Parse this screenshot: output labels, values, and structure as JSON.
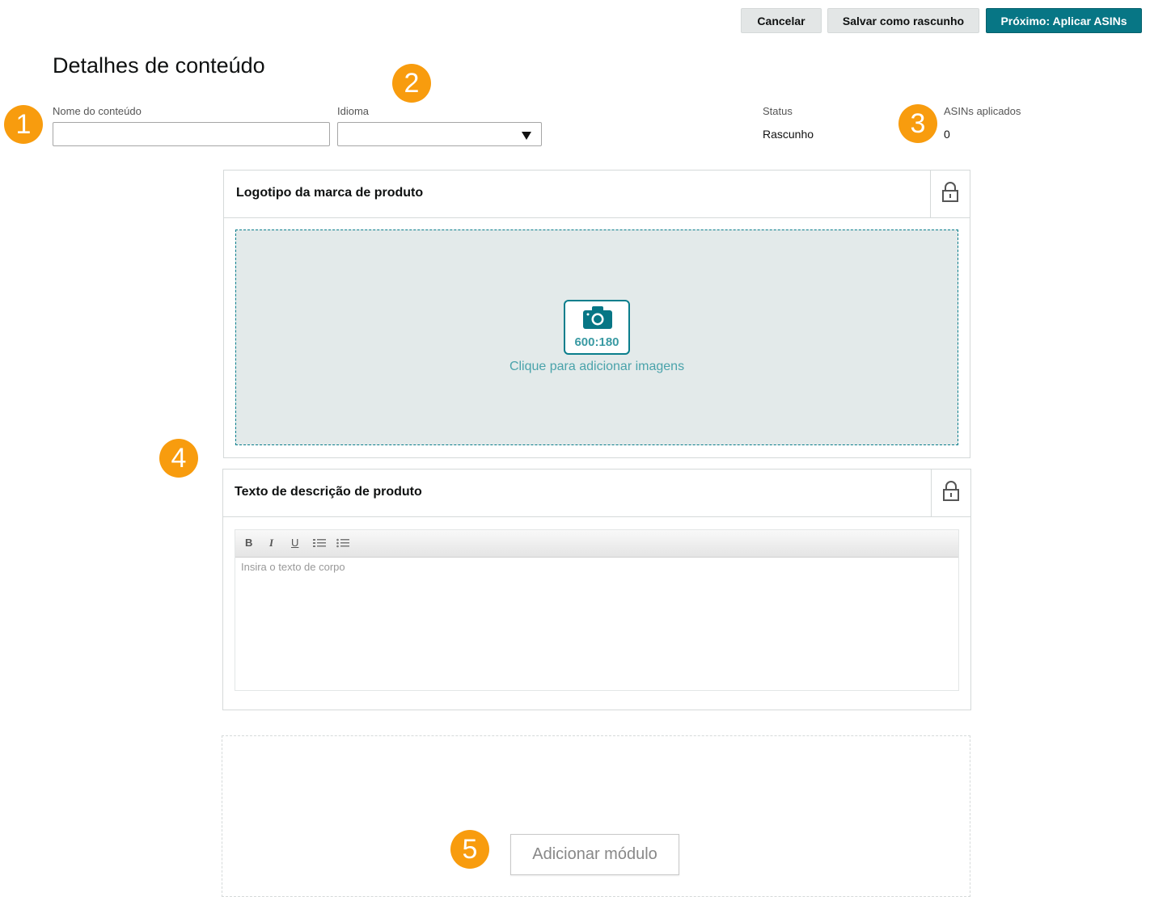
{
  "header": {
    "cancel_label": "Cancelar",
    "save_draft_label": "Salvar como rascunho",
    "next_label": "Próximo: Aplicar ASINs"
  },
  "page_title": "Detalhes de conteúdo",
  "fields": {
    "content_name_label": "Nome do conteúdo",
    "content_name_value": "",
    "language_label": "Idioma",
    "language_value": "",
    "status_label": "Status",
    "status_value": "Rascunho",
    "asins_label": "ASINs aplicados",
    "asins_value": "0"
  },
  "callouts": [
    "1",
    "2",
    "3",
    "4",
    "5"
  ],
  "modules": {
    "logo": {
      "title": "Logotipo da marca de produto",
      "ratio": "600:180",
      "upload_text": "Clique para adicionar imagens"
    },
    "description": {
      "title": "Texto de descrição de produto",
      "toolbar": {
        "bold": "B",
        "italic": "I",
        "underline": "U"
      },
      "placeholder": "Insira o texto de corpo"
    }
  },
  "add_module_label": "Adicionar módulo",
  "colors": {
    "primary": "#077685",
    "accent_teal": "#0a7e8c",
    "callout_orange": "#f89c0e",
    "dropzone_bg": "#e3eaea"
  }
}
